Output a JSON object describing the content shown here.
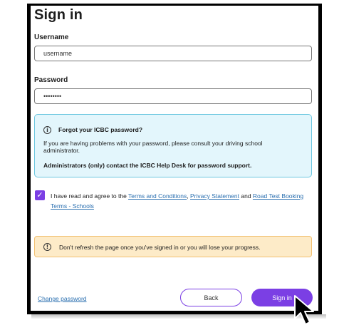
{
  "form": {
    "title": "Sign in",
    "username_label": "Username",
    "username_value": "username",
    "password_label": "Password",
    "password_value": "••••••••"
  },
  "info_box": {
    "heading": "Forgot your ICBC password?",
    "body": "If you are having problems with your password, please consult your driving school administrator.",
    "admin_note": "Administrators (only) contact the ICBC Help Desk for password support."
  },
  "agreement": {
    "checked": true,
    "prefix": "I have read and agree to the",
    "terms_link": "Terms and Conditions",
    "sep1": ",",
    "privacy_link": "Privacy Statement",
    "and": "and",
    "booking_link": "Road Test Booking Terms - Schools"
  },
  "warning": {
    "text": "Don't refresh the page once you've signed in or you will lose your progress."
  },
  "footer": {
    "change_password": "Change password",
    "back_label": "Back",
    "signin_label": "Sign in"
  },
  "icons": {
    "info": "info-circle-icon",
    "checkmark": "checkmark-icon",
    "cursor": "mouse-pointer-icon"
  },
  "colors": {
    "accent": "#7b3fe4",
    "info_bg": "#e3f6fc",
    "info_border": "#6cc7e0",
    "warn_bg": "#fdebc8",
    "warn_border": "#f2c071",
    "link": "#2a6fb0"
  }
}
